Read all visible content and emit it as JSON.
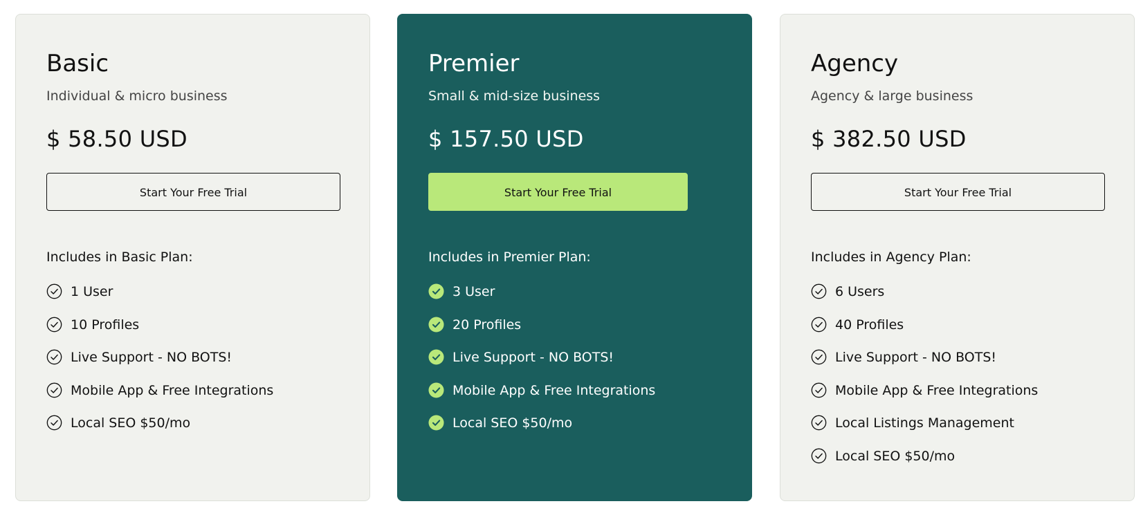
{
  "plans": [
    {
      "name": "Basic",
      "subtitle": "Individual & micro business",
      "price": "$ 58.50 USD",
      "cta_label": "Start Your Free Trial",
      "includes_heading": "Includes in Basic Plan:",
      "featured": false,
      "features": [
        "1 User",
        "10 Profiles",
        "Live Support - NO BOTS!",
        "Mobile App & Free Integrations",
        "Local SEO $50/mo"
      ]
    },
    {
      "name": "Premier",
      "subtitle": "Small & mid-size business",
      "price": "$ 157.50 USD",
      "cta_label": "Start Your Free Trial",
      "includes_heading": "Includes in Premier Plan:",
      "featured": true,
      "features": [
        "3 User",
        "20 Profiles",
        "Live Support - NO BOTS!",
        "Mobile App & Free Integrations",
        "Local SEO $50/mo"
      ]
    },
    {
      "name": "Agency",
      "subtitle": "Agency & large business",
      "price": "$ 382.50 USD",
      "cta_label": "Start Your Free Trial",
      "includes_heading": "Includes in Agency Plan:",
      "featured": false,
      "features": [
        "6 Users",
        "40 Profiles",
        "Live Support - NO BOTS!",
        "Mobile App & Free Integrations",
        "Local Listings Management",
        "Local SEO $50/mo"
      ]
    }
  ],
  "icons": {
    "feature_check": "check-circle-icon"
  },
  "colors": {
    "featured_card_bg": "#1a5e5d",
    "featured_cta_bg": "#b9e87a",
    "featured_check": "#b9e87a",
    "light_card_bg": "#f1f2ee"
  }
}
